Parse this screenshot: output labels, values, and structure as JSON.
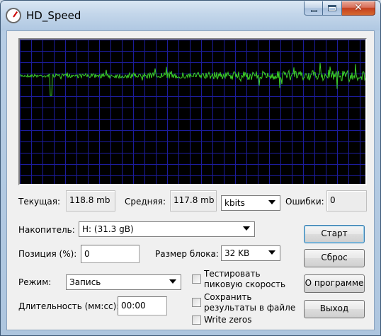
{
  "window": {
    "title": "HD_Speed",
    "close_glyph": "✕"
  },
  "graph": {
    "background": "#000000",
    "grid_color": "#1c1c9c",
    "trace_color": "#3cd12a",
    "level": 0.75,
    "spike_positions": [
      0.09
    ],
    "noise_growth": "increases toward right"
  },
  "stats": {
    "current_label": "Текущая:",
    "current_value": "118.8 mb",
    "average_label": "Средняя:",
    "average_value": "117.8 mb",
    "unit_select": "kbits",
    "errors_label": "Ошибки:",
    "errors_value": "0"
  },
  "settings": {
    "drive_label": "Накопитель:",
    "drive_value": "H: (31.3 gB)",
    "position_label": "Позиция (%):",
    "position_value": "0",
    "block_label": "Размер блока:",
    "block_value": "32 KB",
    "mode_label": "Режим:",
    "mode_value": "Запись",
    "duration_label": "Длительность (мм:сс):",
    "duration_value": "00:00"
  },
  "checkboxes": [
    {
      "label_line1": "Тестировать",
      "label_line2": "пиковую скорость",
      "checked": false
    },
    {
      "label_line1": "Сохранить",
      "label_line2": "результаты в файле",
      "checked": false
    },
    {
      "label_line1": "Write zeros",
      "label_line2": "",
      "checked": false
    }
  ],
  "buttons": {
    "start": "Старт",
    "reset": "Сброс",
    "about": "О программе",
    "exit": "Выход"
  }
}
